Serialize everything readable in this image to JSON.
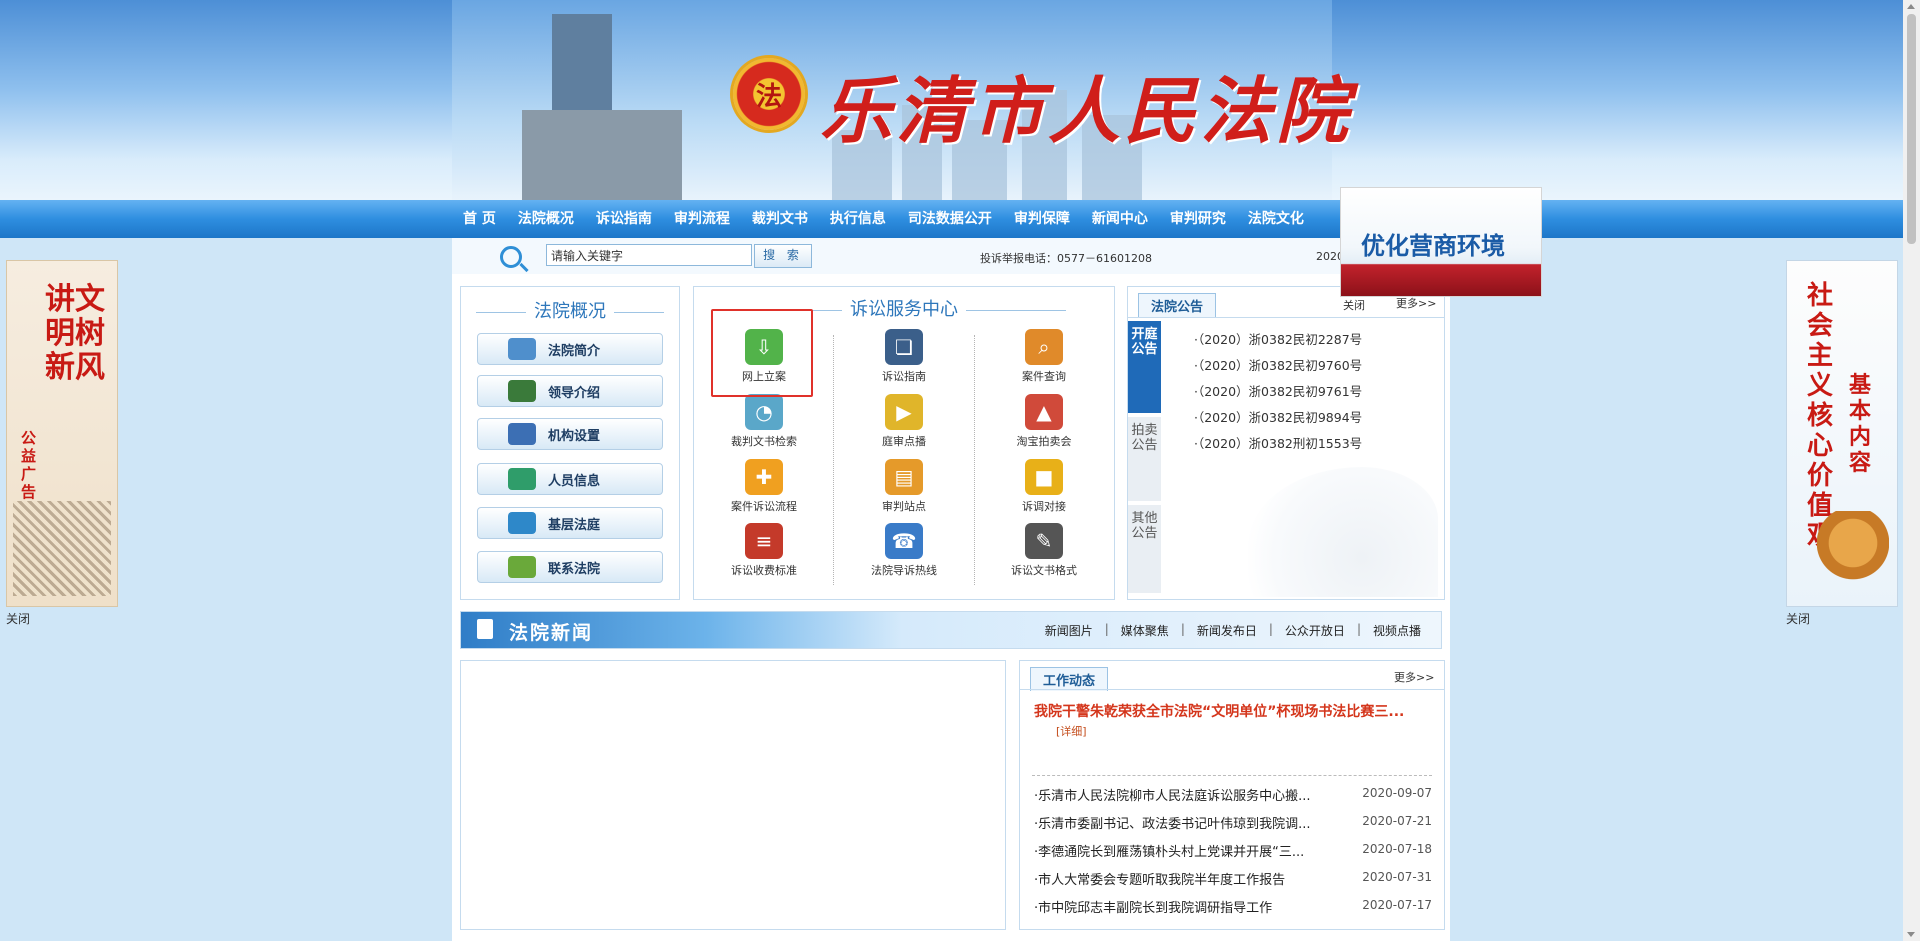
{
  "header": {
    "site_title": "乐清市人民法院",
    "emblem_glyph": "法"
  },
  "nav": {
    "items": [
      "首 页",
      "法院概况",
      "诉讼指南",
      "审判流程",
      "裁判文书",
      "执行信息",
      "司法数据公开",
      "审判保障",
      "新闻中心",
      "审判研究",
      "法院文化"
    ]
  },
  "search": {
    "value": "请输入关键字",
    "button": "搜 索",
    "hotline": "投诉举报电话：0577－61601208",
    "date": "2020"
  },
  "overview": {
    "title": "法院概况",
    "items": [
      {
        "label": "法院简介",
        "icon": "building-icon",
        "color": "#4f8fcc"
      },
      {
        "label": "领导介绍",
        "icon": "graduation-cap-icon",
        "color": "#3a7a3a"
      },
      {
        "label": "机构设置",
        "icon": "computer-icon",
        "color": "#3c6fb4"
      },
      {
        "label": "人员信息",
        "icon": "globe-icon",
        "color": "#2f9d6a"
      },
      {
        "label": "基层法庭",
        "icon": "network-icon",
        "color": "#2e88c9"
      },
      {
        "label": "联系法院",
        "icon": "mail-icon",
        "color": "#6aa93a"
      }
    ]
  },
  "services": {
    "title": "诉讼服务中心",
    "items": [
      {
        "label": "网上立案",
        "icon": "download-icon",
        "color": "#52b34a",
        "glyph": "⇩"
      },
      {
        "label": "诉讼指南",
        "icon": "book-icon",
        "color": "#3b5f8a",
        "glyph": "❏"
      },
      {
        "label": "案件查询",
        "icon": "search-doc-icon",
        "color": "#e08a2a",
        "glyph": "⌕"
      },
      {
        "label": "裁判文书检索",
        "icon": "magnifier-icon",
        "color": "#5aa7c9",
        "glyph": "◔"
      },
      {
        "label": "庭审点播",
        "icon": "video-icon",
        "color": "#e0b52a",
        "glyph": "▶"
      },
      {
        "label": "淘宝拍卖会",
        "icon": "chart-icon",
        "color": "#d04a3a",
        "glyph": "▲"
      },
      {
        "label": "案件诉讼流程",
        "icon": "flow-icon",
        "color": "#f0a020",
        "glyph": "✚"
      },
      {
        "label": "审判站点",
        "icon": "folder-icon",
        "color": "#e59a2a",
        "glyph": "▤"
      },
      {
        "label": "诉调对接",
        "icon": "cube-icon",
        "color": "#e8b018",
        "glyph": "■"
      },
      {
        "label": "诉讼收费标准",
        "icon": "books-icon",
        "color": "#c43a2a",
        "glyph": "≡"
      },
      {
        "label": "法院导诉热线",
        "icon": "headset-icon",
        "color": "#3a7bc8",
        "glyph": "☎"
      },
      {
        "label": "诉讼文书格式",
        "icon": "pen-icon",
        "color": "#555555",
        "glyph": "✎"
      }
    ]
  },
  "announcements": {
    "title": "法院公告",
    "close": "关闭",
    "more": "更多>>",
    "tabs": [
      "开庭公告",
      "拍卖公告",
      "其他公告"
    ],
    "items": [
      "·（2020）浙0382民初2287号",
      "·（2020）浙0382民初9760号",
      "·（2020）浙0382民初9761号",
      "·（2020）浙0382民初9894号",
      "·（2020）浙0382刑初1553号"
    ]
  },
  "news_bar": {
    "title": "法院新闻",
    "links": [
      "新闻图片",
      "媒体聚焦",
      "新闻发布日",
      "公众开放日",
      "视频点播"
    ]
  },
  "work": {
    "title": "工作动态",
    "more": "更多>>",
    "headline": "我院干警朱乾荣获全市法院“文明单位”杯现场书法比赛三...",
    "detail": "[详细]",
    "items": [
      {
        "title": "·乐清市人民法院柳市人民法庭诉讼服务中心搬...",
        "date": "2020-09-07"
      },
      {
        "title": "·乐清市委副书记、政法委书记叶伟琼到我院调...",
        "date": "2020-07-21"
      },
      {
        "title": "·李德通院长到雁荡镇朴头村上党课并开展“三...",
        "date": "2020-07-18"
      },
      {
        "title": "·市人大常委会专题听取我院半年度工作报告",
        "date": "2020-07-31"
      },
      {
        "title": "·市中院邱志丰副院长到我院调研指导工作",
        "date": "2020-07-17"
      }
    ]
  },
  "floats": {
    "left_text_1": "讲文明树新风",
    "left_text_2": "公益广告",
    "left_close": "关闭",
    "right_text_1": "社会主义核心价值观",
    "right_text_2": "基本内容",
    "right_close": "关闭",
    "promo": "优化营商环境"
  }
}
